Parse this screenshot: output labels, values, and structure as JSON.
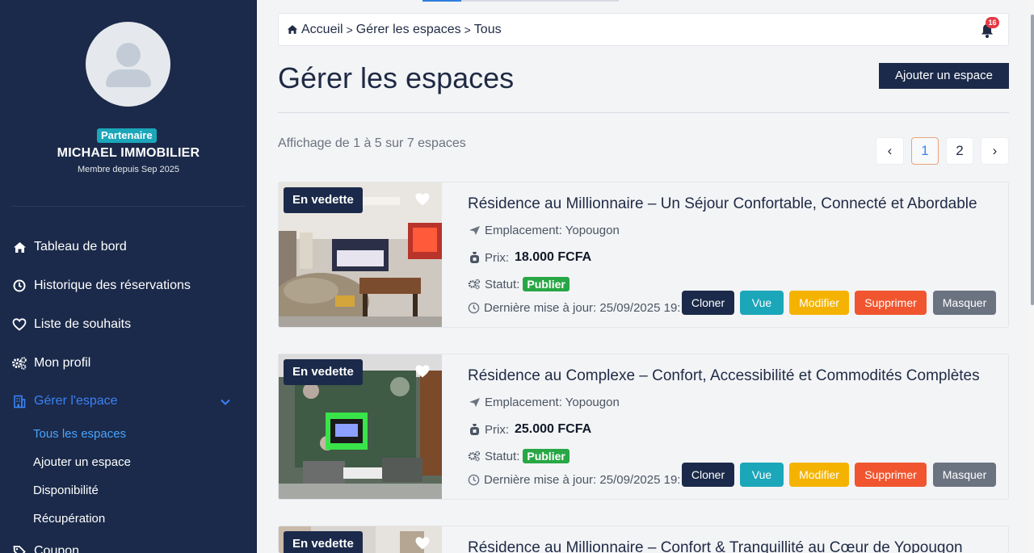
{
  "sidebar": {
    "role_badge": "Partenaire",
    "username": "MICHAEL IMMOBILIER",
    "member_since": "Membre depuis Sep 2025",
    "nav": [
      {
        "label": "Tableau de bord",
        "icon": "home-icon"
      },
      {
        "label": "Historique des réservations",
        "icon": "clock-icon"
      },
      {
        "label": "Liste de souhaits",
        "icon": "heart-icon"
      },
      {
        "label": "Mon profil",
        "icon": "gears-icon"
      },
      {
        "label": "Gérer l'espace",
        "icon": "building-icon",
        "active": true
      },
      {
        "label": "Coupon",
        "icon": "tag-icon"
      }
    ],
    "sub_items": [
      {
        "label": "Tous les espaces",
        "active": true
      },
      {
        "label": "Ajouter un espace"
      },
      {
        "label": "Disponibilité"
      },
      {
        "label": "Récupération"
      }
    ]
  },
  "breadcrumb": {
    "items": [
      "Accueil",
      "Gérer les espaces",
      "Tous"
    ],
    "separator": ">"
  },
  "notifications": {
    "count": "16"
  },
  "page": {
    "title": "Gérer les espaces",
    "add_button": "Ajouter un espace",
    "showing": "Affichage de 1 à 5 sur 7 espaces"
  },
  "pagination": {
    "prev": "‹",
    "pages": [
      "1",
      "2"
    ],
    "next": "›",
    "current": "1"
  },
  "listings": [
    {
      "badge": "En vedette",
      "title": "Résidence au Millionnaire – Un Séjour Confortable, Connecté et Abordable",
      "location_label": "Emplacement: Yopougon",
      "price_label": "Prix:",
      "price": "18.000 FCFA",
      "status_label": "Statut:",
      "status": "Publier",
      "updated": "Dernière mise à jour: 25/09/2025 19:"
    },
    {
      "badge": "En vedette",
      "title": "Résidence au Complexe – Confort, Accessibilité et Commodités Complètes",
      "location_label": "Emplacement: Yopougon",
      "price_label": "Prix:",
      "price": "25.000 FCFA",
      "status_label": "Statut:",
      "status": "Publier",
      "updated": "Dernière mise à jour: 25/09/2025 19:"
    },
    {
      "badge": "En vedette",
      "title": "Résidence au Millionnaire – Confort & Tranquillité au Cœur de Yopougon"
    }
  ],
  "actions": {
    "clone": "Cloner",
    "view": "Vue",
    "edit": "Modifier",
    "delete": "Supprimer",
    "hide": "Masquer"
  },
  "colors": {
    "sidebar_bg": "#1b2a4a",
    "accent_blue": "#3b82f6",
    "teal": "#1ba6b9",
    "yellow": "#f5b301",
    "orange_red": "#f0552f",
    "gray": "#6b7280",
    "status_green": "#28a745"
  }
}
